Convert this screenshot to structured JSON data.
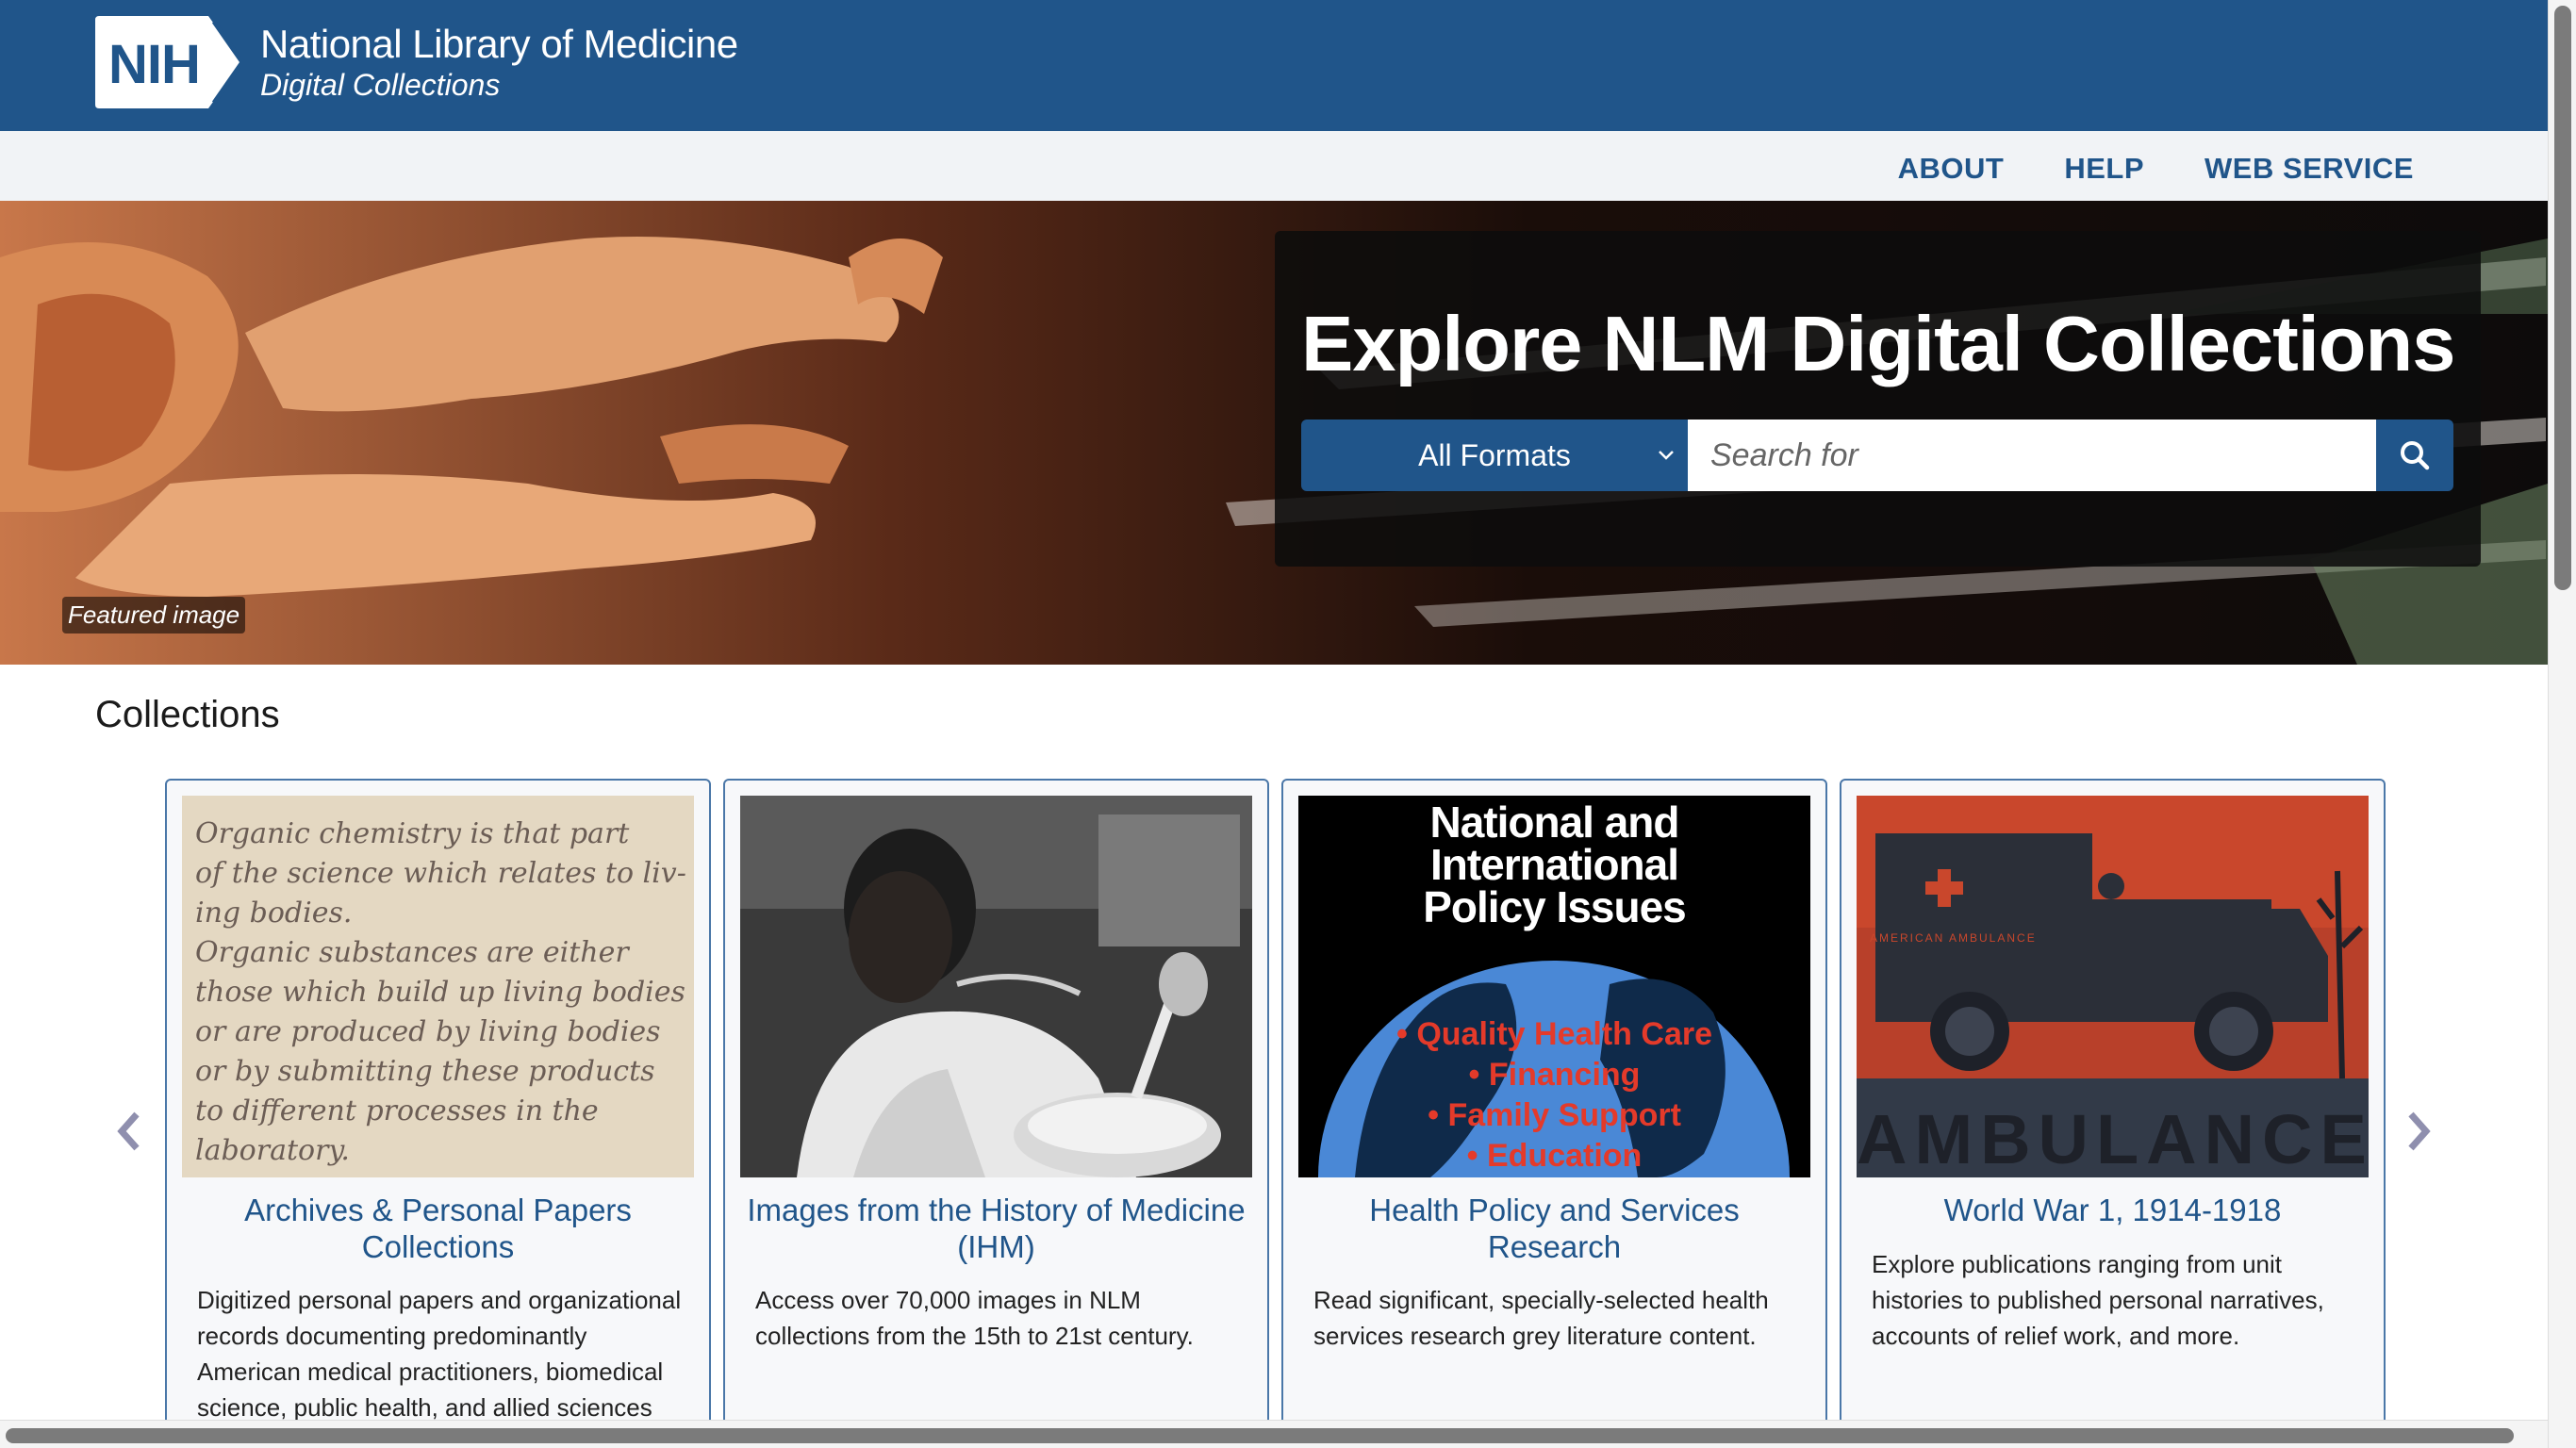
{
  "header": {
    "logo_mark": "NIH",
    "title": "National Library of Medicine",
    "subtitle": "Digital Collections",
    "brand_color": "#20558a"
  },
  "nav": {
    "items": [
      {
        "label": "ABOUT"
      },
      {
        "label": "HELP"
      },
      {
        "label": "WEB SERVICE"
      }
    ]
  },
  "hero": {
    "badge": "Featured image",
    "title": "Explore NLM Digital Collections",
    "format_selected": "All Formats",
    "search_placeholder": "Search for"
  },
  "collections": {
    "heading": "Collections",
    "prev_icon": "chevron-left-icon",
    "next_icon": "chevron-right-icon",
    "cards": [
      {
        "title": "Archives & Personal Papers Collections",
        "description": "Digitized personal papers and organizational records documenting predominantly American medical practitioners, biomedical science, public health, and allied sciences",
        "image_lines": [
          "Organic chemistry is that part",
          "of the science which relates to liv-",
          "ing bodies.",
          "Organic substances are either",
          "those which build up living bodies",
          "or are produced by living bodies",
          "or by submitting these products",
          "to different processes in the",
          "laboratory."
        ]
      },
      {
        "title": "Images from the History of Medicine (IHM)",
        "description": "Access over 70,000 images in NLM collections from the 15th to 21st century."
      },
      {
        "title": "Health Policy and Services Research",
        "description": "Read significant, specially-selected health services research grey literature content.",
        "poster_title": [
          "National and",
          "International",
          "Policy Issues"
        ],
        "poster_items": [
          "• Quality Health Care",
          "• Financing",
          "• Family Support",
          "• Education"
        ]
      },
      {
        "title": "World War 1, 1914-1918",
        "description": "Explore publications ranging from unit histories to published personal narratives, accounts of relief work, and more.",
        "poster_text": "AMBULANCE",
        "poster_small": "AMERICAN AMBULANCE"
      }
    ]
  }
}
